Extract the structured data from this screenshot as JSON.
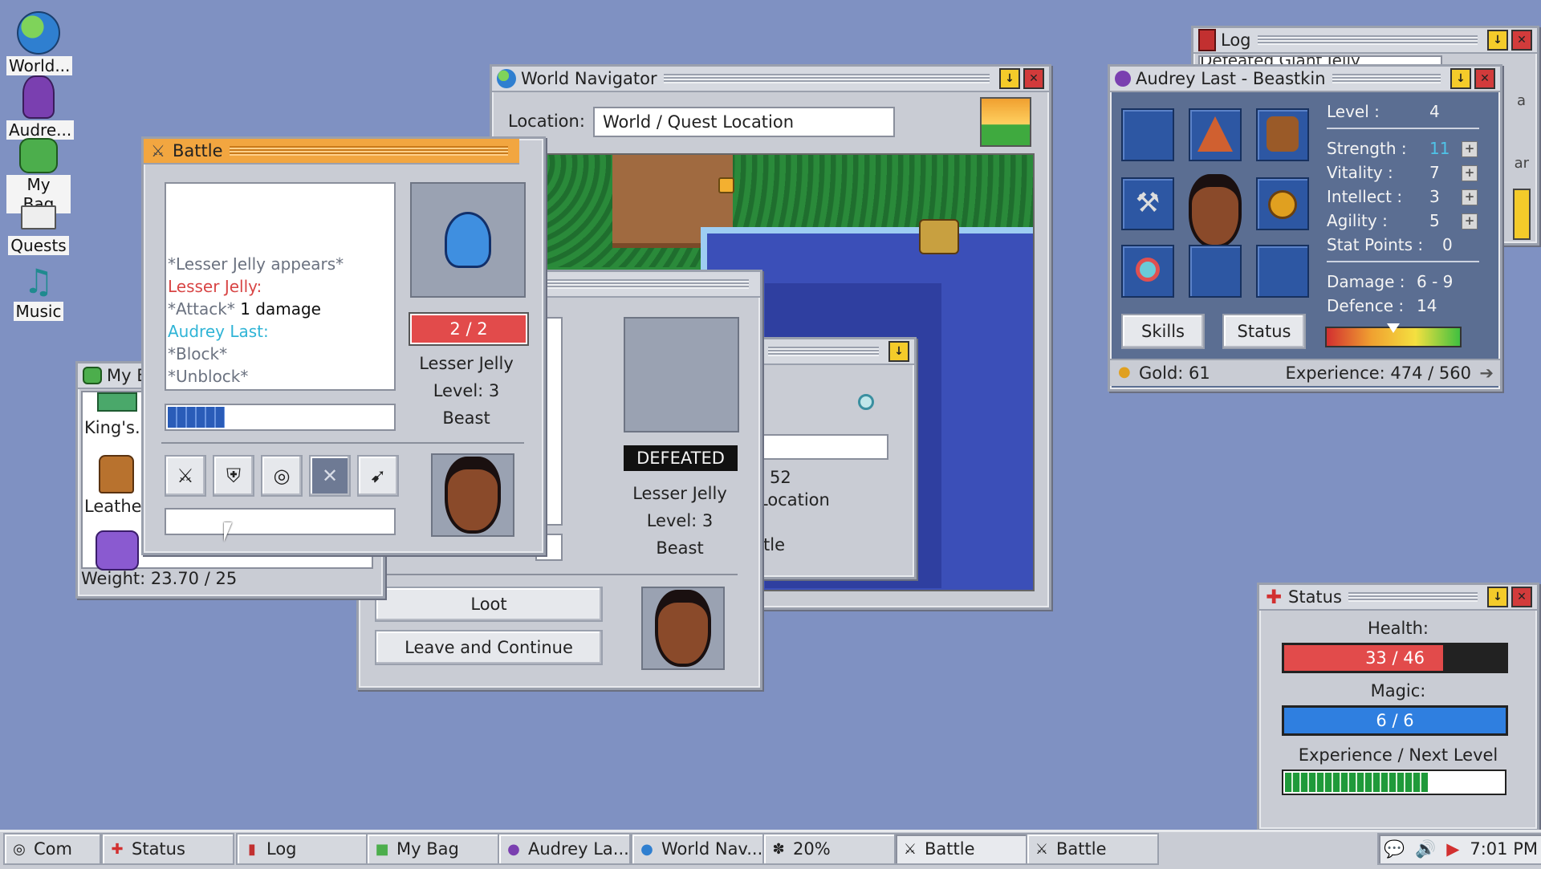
{
  "desktop": {
    "icons": [
      {
        "label": "World...",
        "icon": "globe-icon"
      },
      {
        "label": "Audre...",
        "icon": "beastkin-character-icon"
      },
      {
        "label": "My Bag",
        "icon": "backpack-icon"
      },
      {
        "label": "Quests",
        "icon": "envelope-icon"
      },
      {
        "label": "Music",
        "icon": "music-note-icon"
      }
    ]
  },
  "battle": {
    "title": "Battle",
    "log": [
      {
        "text": "*Lesser Jelly appears*",
        "color": "#6b7280"
      },
      {
        "text": "Lesser Jelly:",
        "color": "#d84545"
      },
      {
        "text": "*Attack*",
        "color": "#6b7280",
        "extra": " 1 damage"
      },
      {
        "text": "Audrey Last:",
        "color": "#2fb4d6"
      },
      {
        "text": "*Block*",
        "color": "#6b7280"
      },
      {
        "text": "*Unblock*",
        "color": "#6b7280"
      }
    ],
    "turn_progress": 0.25,
    "enemy_hp": "2 / 2",
    "enemy_name": "Lesser Jelly",
    "enemy_level": "Level: 3",
    "enemy_type": "Beast",
    "actions": [
      "attack-action-icon",
      "block-action-icon",
      "focus-action-icon",
      "cancel-action-icon",
      "flee-action-icon"
    ],
    "command_input": ""
  },
  "result": {
    "status": "DEFEATED",
    "enemy_name": "Lesser Jelly",
    "enemy_level": "Level: 3",
    "enemy_type": "Beast",
    "log_fragment": "*",
    "loot_label": "Loot",
    "continue_label": "Leave and Continue"
  },
  "world": {
    "title": "World Navigator",
    "location_label": "Location:",
    "location_value": "World / Quest Location"
  },
  "hidden_win": {
    "lines": [
      "52",
      "Location",
      "tle"
    ]
  },
  "bag": {
    "title": "My Bag",
    "items": [
      "King's...",
      "Leathe..."
    ],
    "weight": "Weight: 23.70 / 25"
  },
  "log": {
    "title": "Log",
    "first_line": "Defeated Giant Jelly",
    "side_text": [
      "a",
      "ar"
    ]
  },
  "character": {
    "title": "Audrey Last - Beastkin",
    "level_label": "Level :",
    "level": "4",
    "stats": [
      {
        "label": "Strength :",
        "value": "11",
        "color": "#4fc3e8"
      },
      {
        "label": "Vitality :",
        "value": "7",
        "color": "#f4f4f4"
      },
      {
        "label": "Intellect :",
        "value": "3",
        "color": "#f4f4f4"
      },
      {
        "label": "Agility :",
        "value": "5",
        "color": "#f4f4f4"
      }
    ],
    "stat_points_label": "Stat Points :",
    "stat_points": "0",
    "damage_label": "Damage :",
    "damage": "6 - 9",
    "defence_label": "Defence :",
    "defence": "14",
    "skills_label": "Skills",
    "status_label": "Status",
    "gold": "Gold: 61",
    "experience": "Experience: 474 / 560",
    "alignment": 0.5,
    "equipment": [
      "amulet-slot-icon",
      "wizard-hat-icon",
      "leather-armor-icon",
      "axe-icon",
      "portrait",
      "shield-icon",
      "ring-icon",
      "boots-slot-icon",
      "ring-slot-icon"
    ]
  },
  "status": {
    "title": "Status",
    "health_label": "Health:",
    "health_text": "33 / 46",
    "health": 0.717,
    "magic_label": "Magic:",
    "magic_text": "6 / 6",
    "magic": 1.0,
    "exp_label": "Experience / Next Level",
    "exp": 0.646
  },
  "taskbar": {
    "items": [
      {
        "label": "Com",
        "icon": "disc-icon"
      },
      {
        "label": "Status",
        "icon": "red-cross-icon"
      },
      {
        "label": "Log",
        "icon": "book-icon"
      },
      {
        "label": "My Bag",
        "icon": "backpack-icon"
      },
      {
        "label": "Audrey La...",
        "icon": "character-icon"
      },
      {
        "label": "World Nav...",
        "icon": "globe-icon"
      },
      {
        "label": "20%",
        "icon": "loading-icon"
      },
      {
        "label": "Battle",
        "icon": "crossed-swords-icon"
      },
      {
        "label": "Battle",
        "icon": "crossed-swords-icon"
      }
    ],
    "clock": "7:01 PM"
  },
  "colors": {
    "desktop": "#7f91c2",
    "health": "#e24b4b",
    "magic": "#2f7fe0",
    "exp": "#1f9a3a"
  }
}
